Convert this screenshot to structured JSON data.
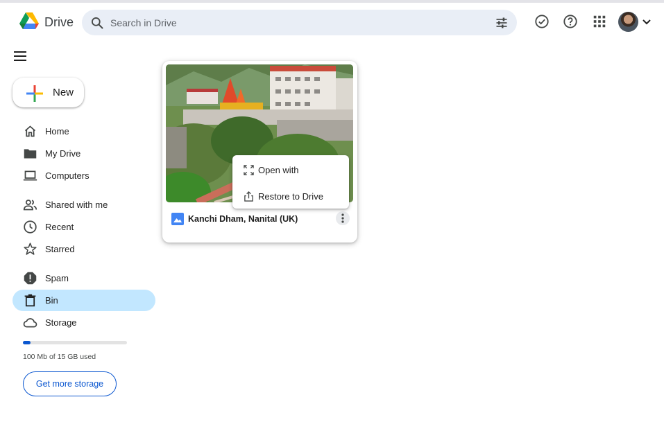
{
  "app": {
    "brand": "Drive"
  },
  "search": {
    "placeholder": "Search in Drive"
  },
  "header_icons": [
    "ready-for-offline-icon",
    "help-icon",
    "apps-grid-icon",
    "account-avatar"
  ],
  "new_button": {
    "label": "New"
  },
  "sidebar": {
    "items": [
      {
        "label": "Home",
        "icon": "home-icon"
      },
      {
        "label": "My Drive",
        "icon": "folder-icon"
      },
      {
        "label": "Computers",
        "icon": "computer-icon"
      },
      {
        "label": "Shared with me",
        "icon": "people-icon"
      },
      {
        "label": "Recent",
        "icon": "clock-icon"
      },
      {
        "label": "Starred",
        "icon": "star-icon"
      },
      {
        "label": "Spam",
        "icon": "spam-icon"
      },
      {
        "label": "Bin",
        "icon": "trash-icon",
        "active": true
      },
      {
        "label": "Storage",
        "icon": "cloud-icon"
      }
    ],
    "storage": {
      "used_fraction": 0.07,
      "text": "100 Mb of 15 GB used",
      "button": "Get more storage"
    }
  },
  "file": {
    "name": "Kanchi Dham, Nanital (UK)",
    "icon": "image-file-icon"
  },
  "context_menu": {
    "items": [
      {
        "label": "Open with",
        "icon": "open-with-icon"
      },
      {
        "label": "Restore to Drive",
        "icon": "restore-icon"
      }
    ]
  },
  "colors": {
    "accent": "#0b57d0",
    "active_nav": "#c2e7ff",
    "search_bg": "#e9eef6"
  }
}
